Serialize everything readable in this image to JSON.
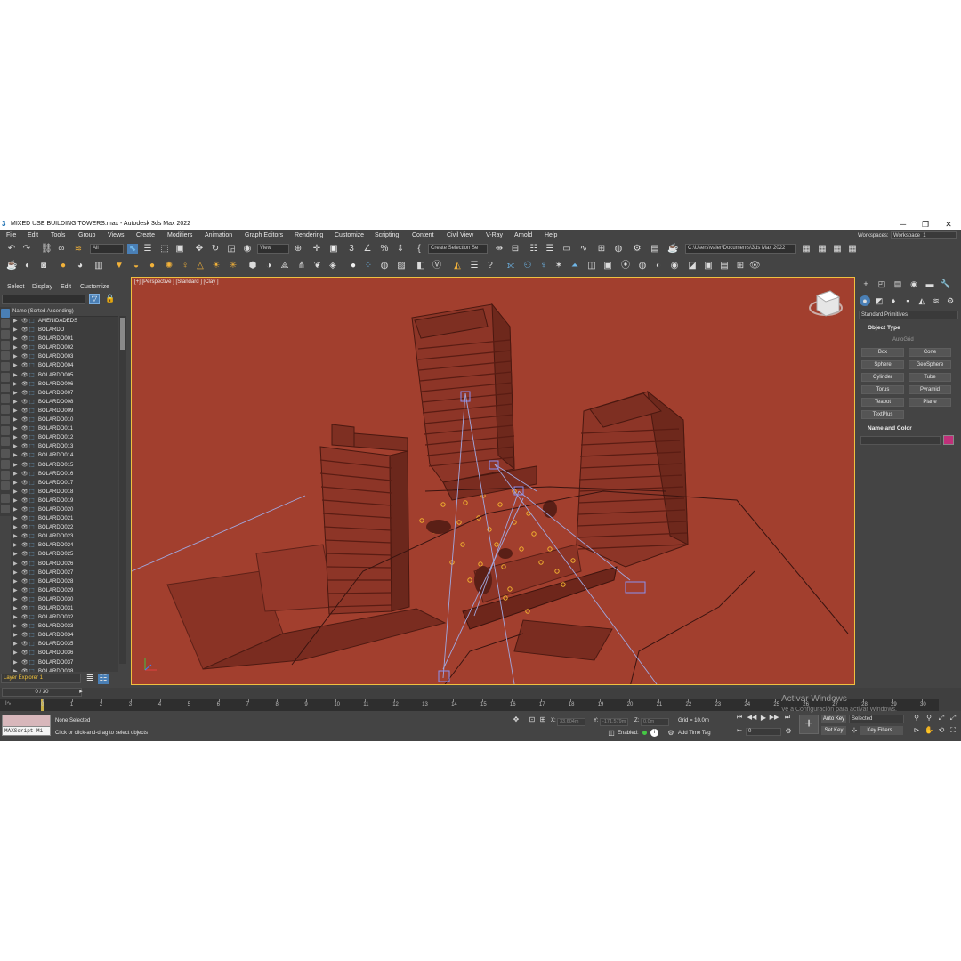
{
  "window": {
    "title": "MIXED USE BUILDING TOWERS.max - Autodesk 3ds Max 2022",
    "logo_glyph": "3",
    "minimize": "─",
    "maximize": "❐",
    "close": "✕"
  },
  "menu": {
    "items": [
      "File",
      "Edit",
      "Tools",
      "Group",
      "Views",
      "Create",
      "Modifiers",
      "Animation",
      "Graph Editors",
      "Rendering",
      "Customize",
      "Scripting",
      "Content",
      "Civil View",
      "V-Ray",
      "Arnold",
      "Help"
    ],
    "workspaces_label": "Workspaces:",
    "workspace_value": "Workspace_1"
  },
  "toolbar": {
    "selection_filter": "All",
    "reference_coord": "View",
    "named_selection": "Create Selection Se",
    "project_path": "C:\\Users\\valer\\Documents\\3ds Max 2022"
  },
  "explorer": {
    "tabs": [
      "Select",
      "Display",
      "Edit",
      "Customize"
    ],
    "column_header": "Name (Sorted Ascending)",
    "rows": [
      "AMENIDADEDS",
      "BOLARDO",
      "BOLARDO001",
      "BOLARDO002",
      "BOLARDO003",
      "BOLARDO004",
      "BOLARDO005",
      "BOLARDO006",
      "BOLARDO007",
      "BOLARDO008",
      "BOLARDO009",
      "BOLARDO010",
      "BOLARDO011",
      "BOLARDO012",
      "BOLARDO013",
      "BOLARDO014",
      "BOLARDO015",
      "BOLARDO016",
      "BOLARDO017",
      "BOLARDO018",
      "BOLARDO019",
      "BOLARDO020",
      "BOLARDO021",
      "BOLARDO022",
      "BOLARDO023",
      "BOLARDO024",
      "BOLARDO025",
      "BOLARDO026",
      "BOLARDO027",
      "BOLARDO028",
      "BOLARDO029",
      "BOLARDO030",
      "BOLARDO031",
      "BOLARDO032",
      "BOLARDO033",
      "BOLARDO034",
      "BOLARDO035",
      "BOLARDO036",
      "BOLARDO037",
      "BOLARDO038"
    ],
    "layer_explorer": "Layer Explorer 1"
  },
  "viewport": {
    "label": "[+] [Perspective ] [Standard ] [Clay ]",
    "background": "#a23f2e",
    "border_color": "#f0c040"
  },
  "command_panel": {
    "category_dropdown": "Standard Primitives",
    "object_type_title": "Object Type",
    "autogrid": "AutoGrid",
    "primitives": [
      "Box",
      "Cone",
      "Sphere",
      "GeoSphere",
      "Cylinder",
      "Tube",
      "Torus",
      "Pyramid",
      "Teapot",
      "Plane",
      "TextPlus"
    ],
    "name_color_title": "Name and Color",
    "swatch_color": "#c0307a"
  },
  "timeline": {
    "frame_counter": "0 / 30",
    "ticks": [
      "0",
      "1",
      "2",
      "3",
      "4",
      "5",
      "6",
      "7",
      "8",
      "9",
      "10",
      "11",
      "12",
      "13",
      "14",
      "15",
      "16",
      "17",
      "18",
      "19",
      "20",
      "21",
      "22",
      "23",
      "24",
      "25",
      "26",
      "27",
      "28",
      "29",
      "30"
    ]
  },
  "status": {
    "maxscript_label": "MAXScript Mi",
    "selection": "None Selected",
    "prompt": "Click or click-and-drag to select objects",
    "x_label": "X:",
    "x_value": "33.604m",
    "y_label": "Y:",
    "y_value": "-171.579m",
    "z_label": "Z:",
    "z_value": "0.0m",
    "grid": "Grid = 10.0m",
    "enabled": "Enabled:",
    "add_time_tag": "Add Time Tag",
    "auto_key": "Auto Key",
    "selected": "Selected",
    "set_key": "Set Key",
    "key_filters": "Key Filters...",
    "frame_field": "0",
    "watermark_title": "Activar Windows",
    "watermark_sub": "Ve a Configuración para activar Windows."
  }
}
